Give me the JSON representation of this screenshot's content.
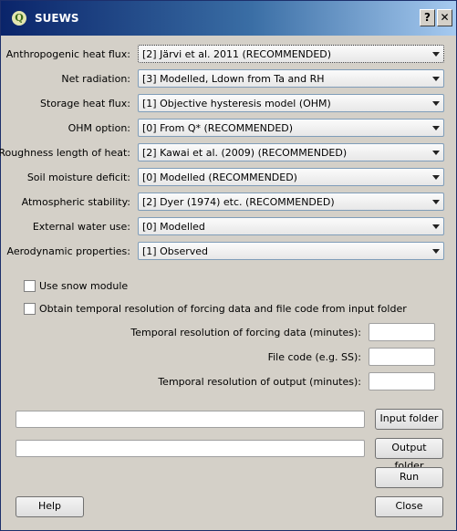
{
  "window": {
    "title": "SUEWS",
    "icon_glyph": "Q",
    "help_glyph": "?",
    "close_glyph": "✕"
  },
  "settings": [
    {
      "label": "Anthropogenic heat flux:",
      "value": "[2] Järvi et al. 2011 (RECOMMENDED)"
    },
    {
      "label": "Net radiation:",
      "value": "[3] Modelled, Ldown from Ta and RH"
    },
    {
      "label": "Storage heat flux:",
      "value": "[1] Objective hysteresis model (OHM)"
    },
    {
      "label": "OHM option:",
      "value": "[0] From Q* (RECOMMENDED)"
    },
    {
      "label": "Roughness length of heat:",
      "value": "[2] Kawai et al. (2009) (RECOMMENDED)"
    },
    {
      "label": "Soil moisture deficit:",
      "value": "[0] Modelled (RECOMMENDED)"
    },
    {
      "label": "Atmospheric stability:",
      "value": "[2] Dyer (1974) etc. (RECOMMENDED)"
    },
    {
      "label": "External water use:",
      "value": "[0] Modelled"
    },
    {
      "label": "Aerodynamic properties:",
      "value": "[1] Observed"
    }
  ],
  "options": {
    "snow_label": "Use snow module",
    "obtain_label": "Obtain temporal resolution of forcing data and file code from input folder",
    "snow_checked": false,
    "obtain_checked": false
  },
  "fields": {
    "forcing_resolution_label": "Temporal resolution of forcing data (minutes):",
    "forcing_resolution_value": "",
    "file_code_label": "File code (e.g. SS):",
    "file_code_value": "",
    "output_resolution_label": "Temporal resolution of output (minutes):",
    "output_resolution_value": ""
  },
  "folders": {
    "input_path": "",
    "input_button": "Input folder",
    "output_path": "",
    "output_button": "Output folder"
  },
  "buttons": {
    "run": "Run",
    "help": "Help",
    "close": "Close"
  }
}
